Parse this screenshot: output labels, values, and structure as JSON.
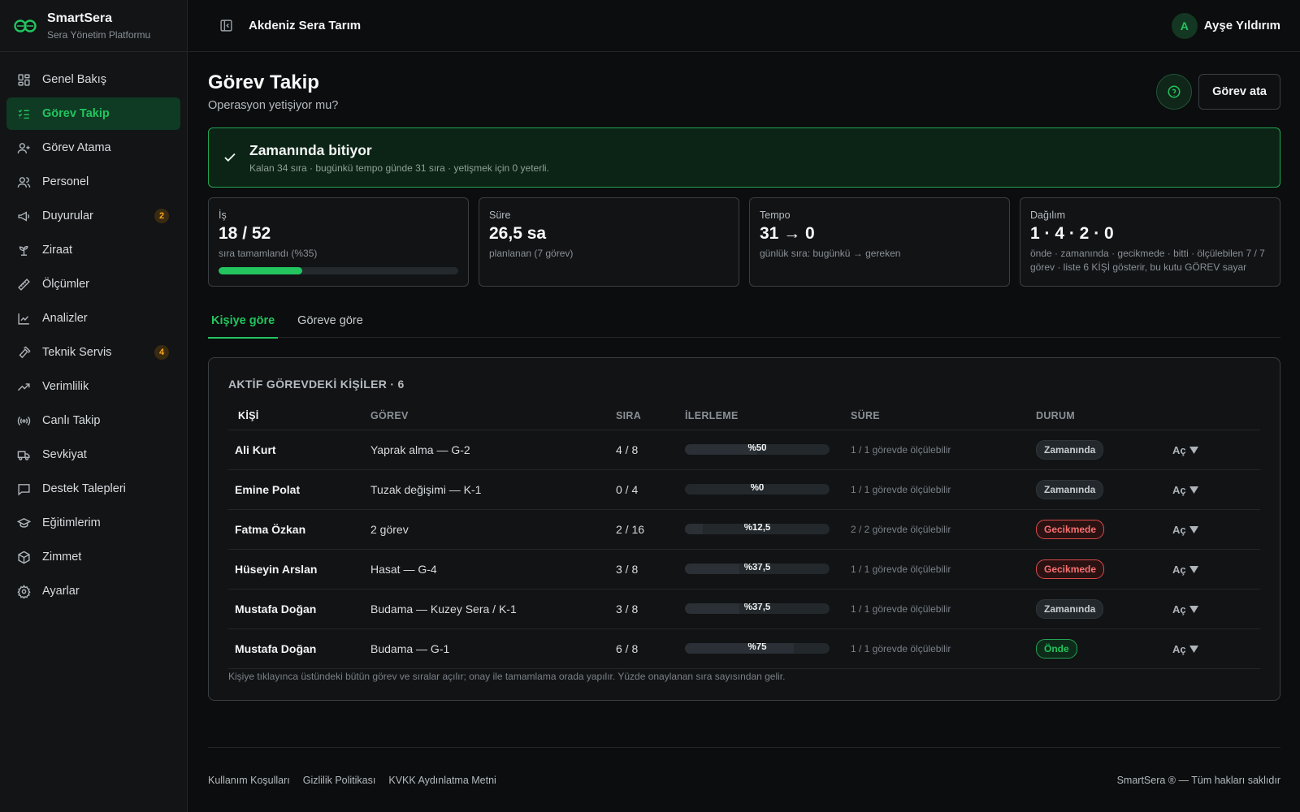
{
  "brand": {
    "name": "SmartSera",
    "subtitle": "Sera Yönetim Platformu",
    "accent": "#22c55e"
  },
  "sidebar": {
    "items": [
      {
        "label": "Genel Bakış",
        "icon": "dashboard-icon"
      },
      {
        "label": "Görev Takip",
        "icon": "checklist-icon",
        "active": true
      },
      {
        "label": "Görev Atama",
        "icon": "user-plus-icon"
      },
      {
        "label": "Personel",
        "icon": "users-icon"
      },
      {
        "label": "Duyurular",
        "icon": "megaphone-icon",
        "badge": "2"
      },
      {
        "label": "Ziraat",
        "icon": "sprout-icon"
      },
      {
        "label": "Ölçümler",
        "icon": "ruler-icon"
      },
      {
        "label": "Analizler",
        "icon": "line-chart-icon"
      },
      {
        "label": "Teknik Servis",
        "icon": "hammer-icon",
        "badge": "4"
      },
      {
        "label": "Verimlilik",
        "icon": "trending-up-icon"
      },
      {
        "label": "Canlı Takip",
        "icon": "broadcast-icon"
      },
      {
        "label": "Sevkiyat",
        "icon": "truck-icon"
      },
      {
        "label": "Destek Talepleri",
        "icon": "message-square-icon"
      },
      {
        "label": "Eğitimlerim",
        "icon": "graduation-cap-icon"
      },
      {
        "label": "Zimmet",
        "icon": "package-icon"
      },
      {
        "label": "Ayarlar",
        "icon": "gear-icon"
      }
    ]
  },
  "topbar": {
    "organization": "Akdeniz Sera Tarım",
    "user_initial": "A",
    "user_name": "Ayşe Yıldırım"
  },
  "page": {
    "title": "Görev Takip",
    "subtitle": "Operasyon yetişiyor mu?",
    "assign_label": "Görev ata"
  },
  "banner": {
    "title": "Zamanında bitiyor",
    "subtitle": "Kalan 34 sıra · bugünkü tempo günde 31 sıra · yetişmek için 0 yeterli."
  },
  "stats": [
    {
      "label": "İş",
      "value": "18 / 52",
      "sub": "sıra tamamlandı (%35)",
      "progress": 0.35
    },
    {
      "label": "Süre",
      "value": "26,5 sa",
      "sub": "planlanan (7 görev)"
    },
    {
      "label": "Tempo",
      "value": "31 → 0",
      "sub": "günlük sıra: bugünkü → gereken"
    },
    {
      "label": "Dağılım",
      "value": "1 · 4 · 2 · 0",
      "sub": "önde · zamanında · gecikmede · bitti · ölçülebilen 7 / 7 görev · liste 6 KİŞİ gösterir, bu kutu GÖREV sayar"
    }
  ],
  "tabs": [
    {
      "label": "Kişiye göre",
      "active": true
    },
    {
      "label": "Göreve göre"
    }
  ],
  "table": {
    "title": "AKTİF GÖREVDEKİ KİŞİLER · 6",
    "headers": [
      "KİŞİ",
      "GÖREV",
      "SIRA",
      "İLERLEME",
      "SÜRE",
      "DURUM",
      ""
    ],
    "rows": [
      {
        "name": "Ali Kurt",
        "task": "Yaprak alma — G-2",
        "seq": "4 / 8",
        "progress": 0.5,
        "progress_label": "%50",
        "duration": "1 / 1 görevde ölçülebilir",
        "status": "Zamanında",
        "status_type": "ok",
        "action": "Aç"
      },
      {
        "name": "Emine Polat",
        "task": "Tuzak değişimi — K-1",
        "seq": "0 / 4",
        "progress": 0,
        "progress_label": "%0",
        "duration": "1 / 1 görevde ölçülebilir",
        "status": "Zamanında",
        "status_type": "ok",
        "action": "Aç"
      },
      {
        "name": "Fatma Özkan",
        "task": "2 görev",
        "seq": "2 / 16",
        "progress": 0.125,
        "progress_label": "%12,5",
        "duration": "2 / 2 görevde ölçülebilir",
        "status": "Gecikmede",
        "status_type": "late",
        "action": "Aç"
      },
      {
        "name": "Hüseyin Arslan",
        "task": "Hasat — G-4",
        "seq": "3 / 8",
        "progress": 0.375,
        "progress_label": "%37,5",
        "duration": "1 / 1 görevde ölçülebilir",
        "status": "Gecikmede",
        "status_type": "late",
        "action": "Aç"
      },
      {
        "name": "Mustafa Doğan",
        "task": "Budama — Kuzey Sera / K-1",
        "seq": "3 / 8",
        "progress": 0.375,
        "progress_label": "%37,5",
        "duration": "1 / 1 görevde ölçülebilir",
        "status": "Zamanında",
        "status_type": "ok",
        "action": "Aç"
      },
      {
        "name": "Mustafa Doğan",
        "task": "Budama — G-1",
        "seq": "6 / 8",
        "progress": 0.75,
        "progress_label": "%75",
        "duration": "1 / 1 görevde ölçülebilir",
        "status": "Önde",
        "status_type": "ahead",
        "action": "Aç"
      }
    ],
    "note": "Kişiye tıklayınca üstündeki bütün görev ve sıralar açılır; onay ile tamamlama orada yapılır. Yüzde onaylanan sıra sayısından gelir."
  },
  "footer": {
    "links": [
      "Kullanım Koşulları",
      "Gizlilik Politikası",
      "KVKK Aydınlatma Metni"
    ],
    "copyright": "SmartSera ® — Tüm hakları saklıdır"
  }
}
